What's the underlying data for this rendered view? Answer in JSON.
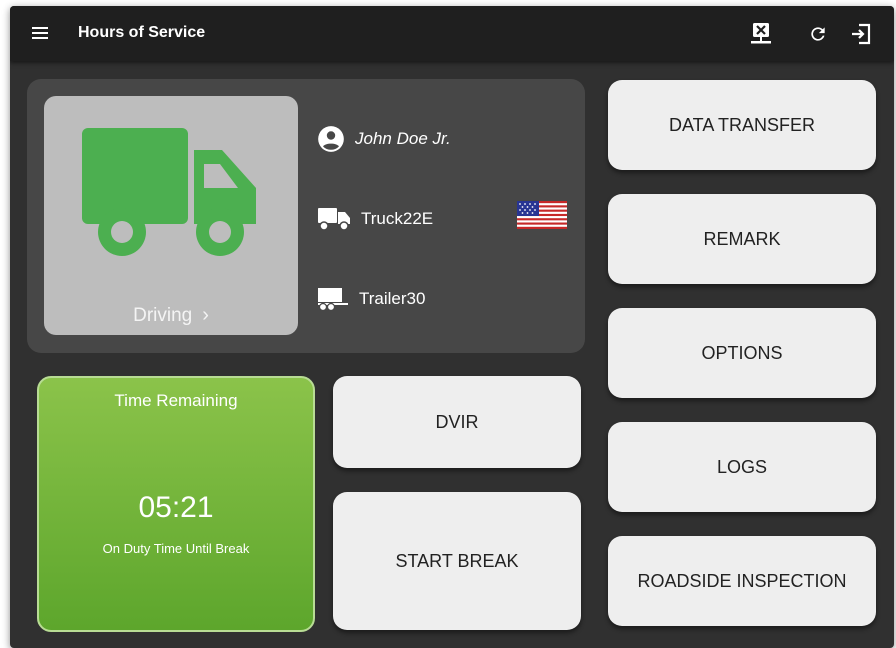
{
  "app_bar": {
    "title": "Hours of Service",
    "icons": {
      "menu": "menu-icon",
      "data_transfer": "network-transfer-icon",
      "refresh": "refresh-icon",
      "logout": "logout-icon"
    }
  },
  "driver_card": {
    "status": "Driving",
    "driver_name": "John Doe Jr.",
    "vehicle": "Truck22E",
    "trailer": "Trailer30",
    "country_flag": "us-flag-icon"
  },
  "time_remaining": {
    "title": "Time Remaining",
    "value": "05:21",
    "subtitle": "On Duty Time Until Break"
  },
  "buttons": {
    "dvir": "DVIR",
    "start_break": "START BREAK",
    "data_transfer": "DATA TRANSFER",
    "remark": "REMARK",
    "options": "OPTIONS",
    "logs": "LOGS",
    "roadside_inspection": "ROADSIDE INSPECTION"
  },
  "colors": {
    "status_green": "#4caf50",
    "time_card_green": "#7cb342",
    "background": "#303030",
    "app_bar": "#1f1f1f"
  }
}
